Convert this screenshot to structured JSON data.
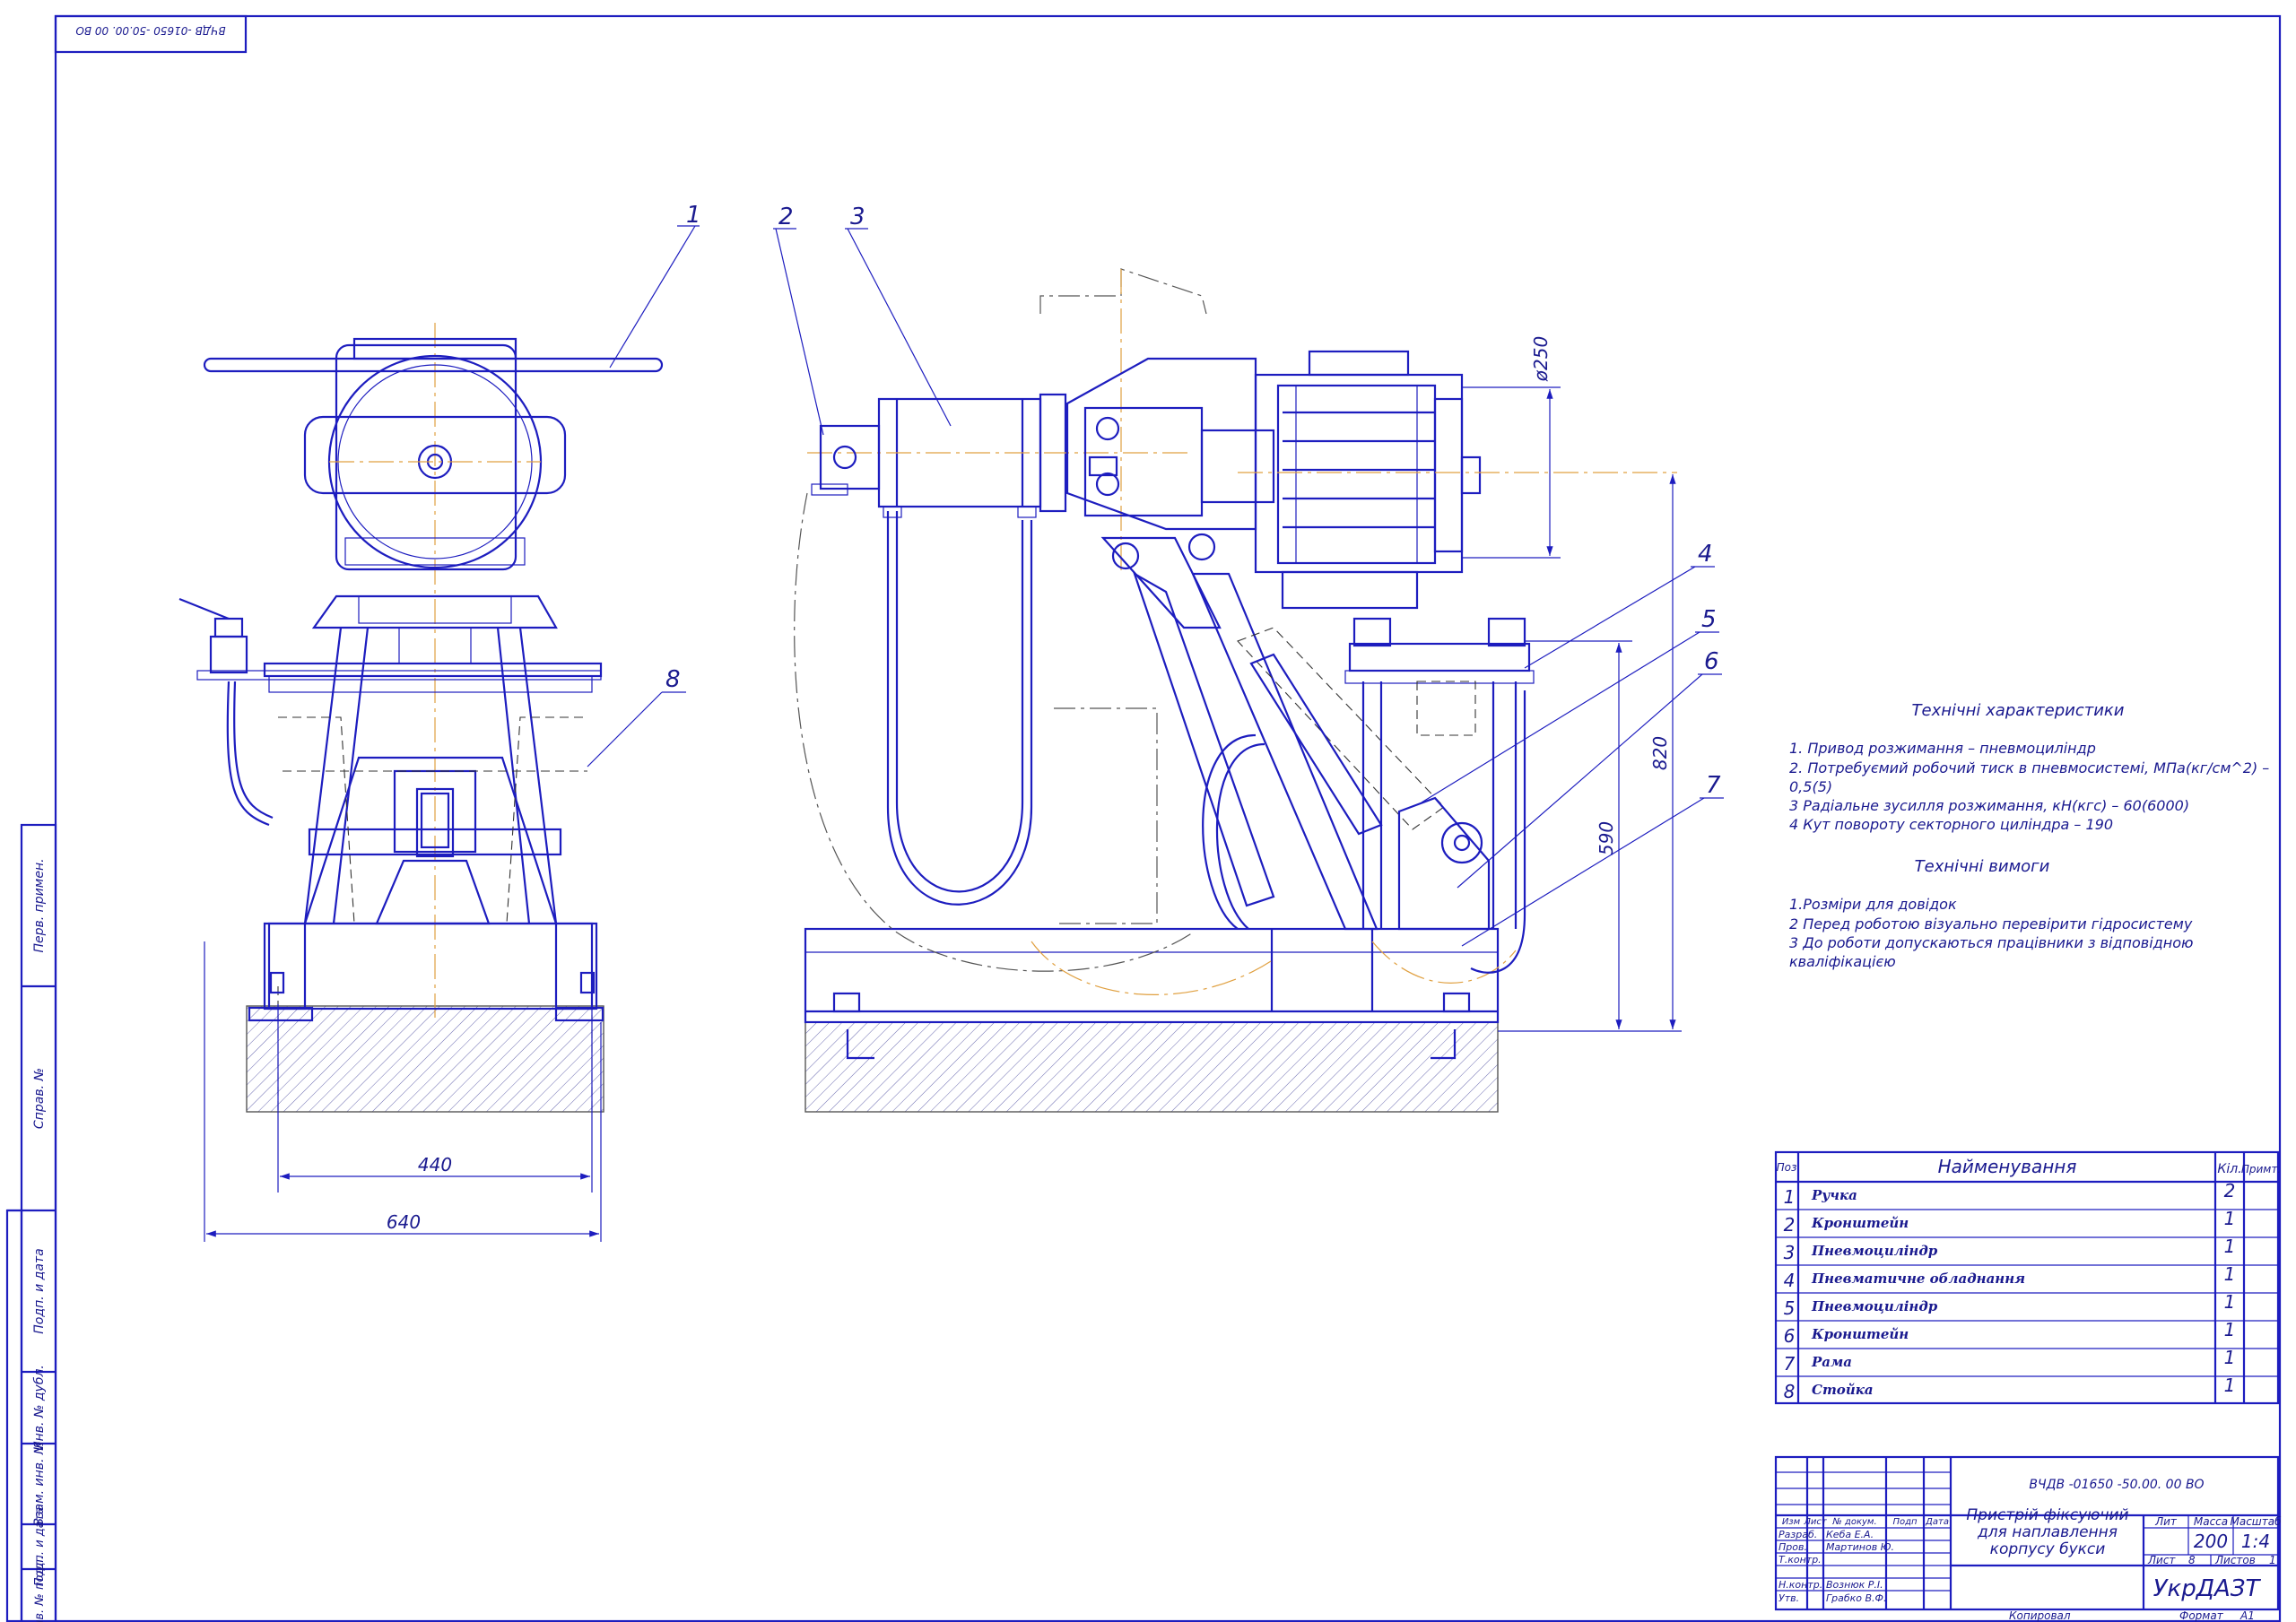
{
  "drawing": {
    "top_stamp": "ВЧДВ -01650 -50.00. 00 ВО",
    "callouts": [
      "1",
      "2",
      "3",
      "4",
      "5",
      "6",
      "7",
      "8"
    ],
    "dimensions": {
      "width_440": "440",
      "width_640": "640",
      "height_590": "590",
      "height_820": "820",
      "diam_250": "ø250"
    }
  },
  "tech_characteristics": {
    "title": "Технічні характеристики",
    "lines": [
      "1. Привод розжимання – пневмоциліндр",
      "2. Потребуємий робочий тиск в пневмосистемі, МПа(кг/см^2) –",
      "0,5(5)",
      "3 Радіальне зусилля розжимання, кН(кгс) – 60(6000)",
      "4 Кут повороту секторного циліндра – 190"
    ]
  },
  "tech_requirements": {
    "title": "Технічні вимоги",
    "lines": [
      "1.Розміри для довідок",
      "2 Перед роботою візуально перевірити гідросистему",
      "3 До роботи допускаються працівники з відповідною",
      "кваліфікацією"
    ]
  },
  "bom": {
    "headers": {
      "pos": "Поз",
      "name": "Найменування",
      "qty": "Кіл.",
      "note": "Примт."
    },
    "rows": [
      {
        "pos": "1",
        "name": "Ручка",
        "qty": "2"
      },
      {
        "pos": "2",
        "name": "Кронштейн",
        "qty": "1"
      },
      {
        "pos": "3",
        "name": "Пневмоциліндр",
        "qty": "1"
      },
      {
        "pos": "4",
        "name": "Пневматичне обладнання",
        "qty": "1"
      },
      {
        "pos": "5",
        "name": "Пневмоциліндр",
        "qty": "1"
      },
      {
        "pos": "6",
        "name": "Кронштейн",
        "qty": "1"
      },
      {
        "pos": "7",
        "name": "Рама",
        "qty": "1"
      },
      {
        "pos": "8",
        "name": "Стойка",
        "qty": "1"
      }
    ]
  },
  "title_block": {
    "doc_code": "ВЧДВ -01650 -50.00. 00 ВО",
    "title_lines": [
      "Пристрій фіксуючий",
      "для наплавлення",
      "корпусу букси"
    ],
    "col_headers": [
      "Изм",
      "Лист",
      "№ докум.",
      "Подп",
      "Дата"
    ],
    "roles": [
      {
        "role": "Разраб.",
        "name": "Кеба Е.А."
      },
      {
        "role": "Пров.",
        "name": "Мартинов Ю."
      },
      {
        "role": "Т.контр.",
        "name": ""
      },
      {
        "role": "",
        "name": ""
      },
      {
        "role": "Н.контр.",
        "name": "Вознюк Р.І."
      },
      {
        "role": "Утв.",
        "name": "Грабко В.Ф."
      }
    ],
    "lit_label": "Лит",
    "mass_label": "Масса",
    "scale_label": "Масштаб",
    "mass_value": "200",
    "scale_value": "1:4",
    "sheet_label": "Лист",
    "sheet_value": "8",
    "sheets_label": "Листов",
    "sheets_value": "1",
    "organization": "УкрДАЗТ",
    "copied": "Копировал",
    "format_label": "Формат",
    "format_value": "А1"
  },
  "side_stamp": {
    "labels": [
      "Перв. примен.",
      "Справ. №",
      "Подп. и дата",
      "Инв. № дубл.",
      "Взам. инв. №",
      "Подп. и дата",
      "Инв. № подл."
    ]
  }
}
